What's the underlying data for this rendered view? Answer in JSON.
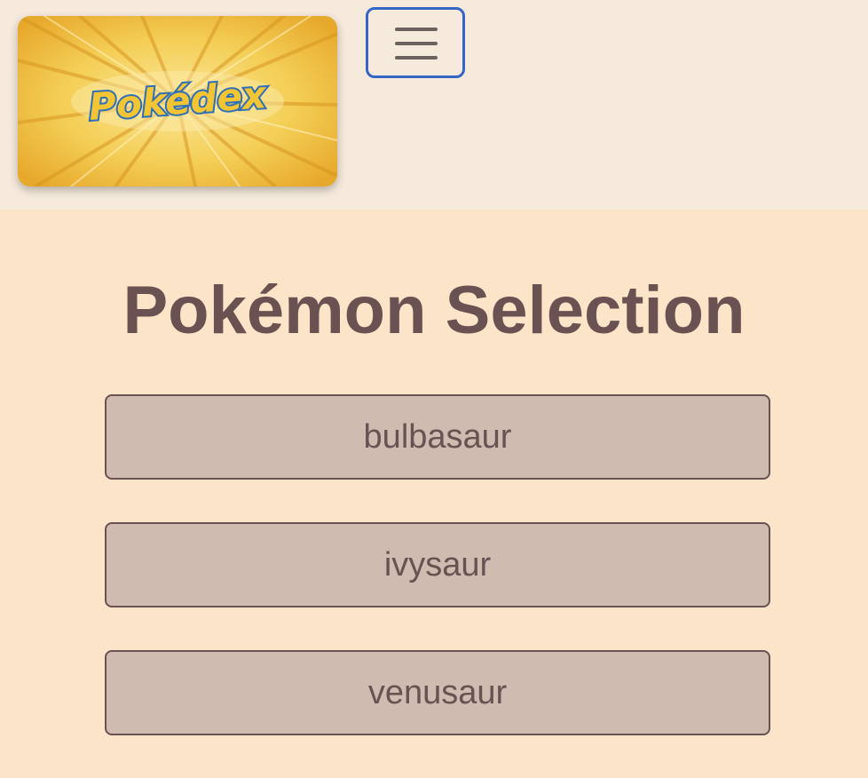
{
  "navbar": {
    "logo_text": "Pokédex",
    "toggler_icon": "hamburger-menu-icon",
    "toggler_focus_color": "#3566c6"
  },
  "main": {
    "title": "Pokémon Selection",
    "pokemon": [
      {
        "name": "bulbasaur"
      },
      {
        "name": "ivysaur"
      },
      {
        "name": "venusaur"
      }
    ]
  },
  "colors": {
    "navbar_bg": "#f6eadd",
    "page_bg": "#fbe4c7",
    "button_bg": "#d0bbb0",
    "text": "#6b5252"
  }
}
